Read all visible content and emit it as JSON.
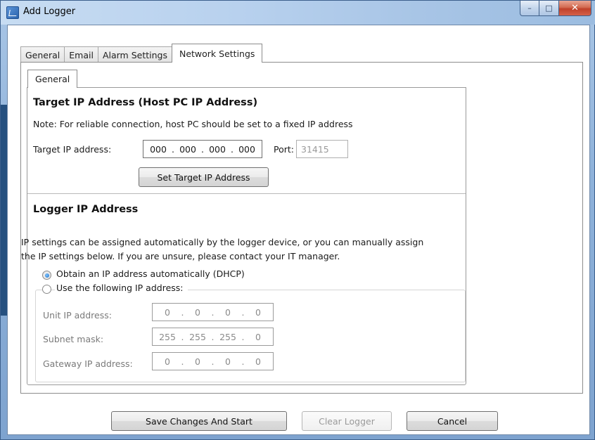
{
  "window": {
    "title": "Add Logger",
    "minimize": "–",
    "maximize": "□",
    "close": "✕"
  },
  "tabs": [
    "General",
    "Email",
    "Alarm Settings",
    "Network Settings"
  ],
  "subtab": "General",
  "target": {
    "heading": "Target IP Address (Host PC IP Address)",
    "note": "Note: For reliable connection, host PC should be set to a fixed IP address",
    "ip_label": "Target IP address:",
    "ip": [
      "000",
      "000",
      "000",
      "000"
    ],
    "port_label": "Port:",
    "port": "31415",
    "set_button": "Set Target IP Address"
  },
  "logger": {
    "heading": "Logger IP Address",
    "desc1": "IP settings can be assigned automatically by the logger device, or you can manually assign",
    "desc2": "the IP settings below. If you are unsure, please contact your IT manager.",
    "radio_dhcp": "Obtain an IP address automatically (DHCP)",
    "radio_static": "Use the following IP address:",
    "unit_label": "Unit IP address:",
    "unit_ip": [
      "0",
      "0",
      "0",
      "0"
    ],
    "subnet_label": "Subnet mask:",
    "subnet": [
      "255",
      "255",
      "255",
      "0"
    ],
    "gateway_label": "Gateway IP address:",
    "gateway": [
      "0",
      "0",
      "0",
      "0"
    ]
  },
  "buttons": {
    "save": "Save Changes And Start",
    "clear": "Clear Logger",
    "cancel": "Cancel"
  },
  "dots": "."
}
